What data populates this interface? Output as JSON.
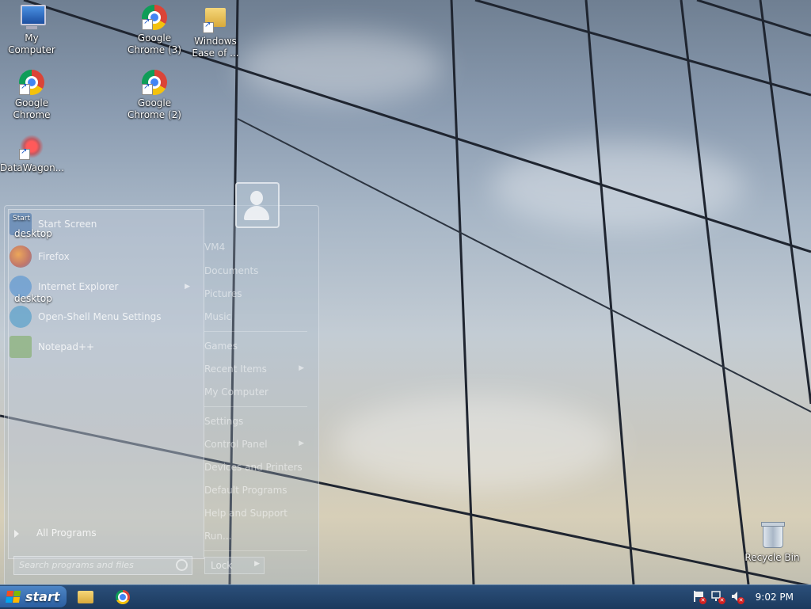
{
  "desktop": {
    "icons": [
      {
        "label": "My Computer"
      },
      {
        "label": "Google Chrome (3)"
      },
      {
        "label": "Windows Ease of ..."
      },
      {
        "label": "Google Chrome"
      },
      {
        "label": "Google Chrome (2)"
      },
      {
        "label": "DataWagon..."
      },
      {
        "label": "Recycle Bin"
      }
    ],
    "overlapped_labels": [
      "desktop",
      "desktop",
      "Start"
    ]
  },
  "start_menu": {
    "pinned": [
      {
        "label": "Start Screen",
        "icon": "start-screen-icon"
      },
      {
        "label": "Firefox",
        "icon": "firefox-icon"
      },
      {
        "label": "Internet Explorer",
        "icon": "internet-explorer-icon",
        "has_submenu": true
      },
      {
        "label": "Open-Shell Menu Settings",
        "icon": "open-shell-icon"
      },
      {
        "label": "Notepad++",
        "icon": "notepadpp-icon"
      }
    ],
    "all_programs": "All Programs",
    "search_placeholder": "Search programs and files",
    "right_items": [
      {
        "label": "VM4"
      },
      {
        "label": "Documents"
      },
      {
        "label": "Pictures"
      },
      {
        "label": "Music"
      },
      {
        "label": "Games"
      },
      {
        "label": "Recent Items",
        "has_submenu": true
      },
      {
        "label": "My Computer"
      },
      {
        "label": "Settings"
      },
      {
        "label": "Control Panel",
        "has_submenu": true
      },
      {
        "label": "Devices and Printers"
      },
      {
        "label": "Default Programs"
      },
      {
        "label": "Help and Support"
      },
      {
        "label": "Run..."
      }
    ],
    "lock_label": "Lock"
  },
  "taskbar": {
    "start_label": "start",
    "clock": "9:02 PM",
    "tray_icons": [
      "action-center-icon",
      "network-icon",
      "volume-muted-icon"
    ]
  },
  "colors": {
    "taskbar": "#1c3a5e",
    "start_button": "#2b5ea0"
  }
}
